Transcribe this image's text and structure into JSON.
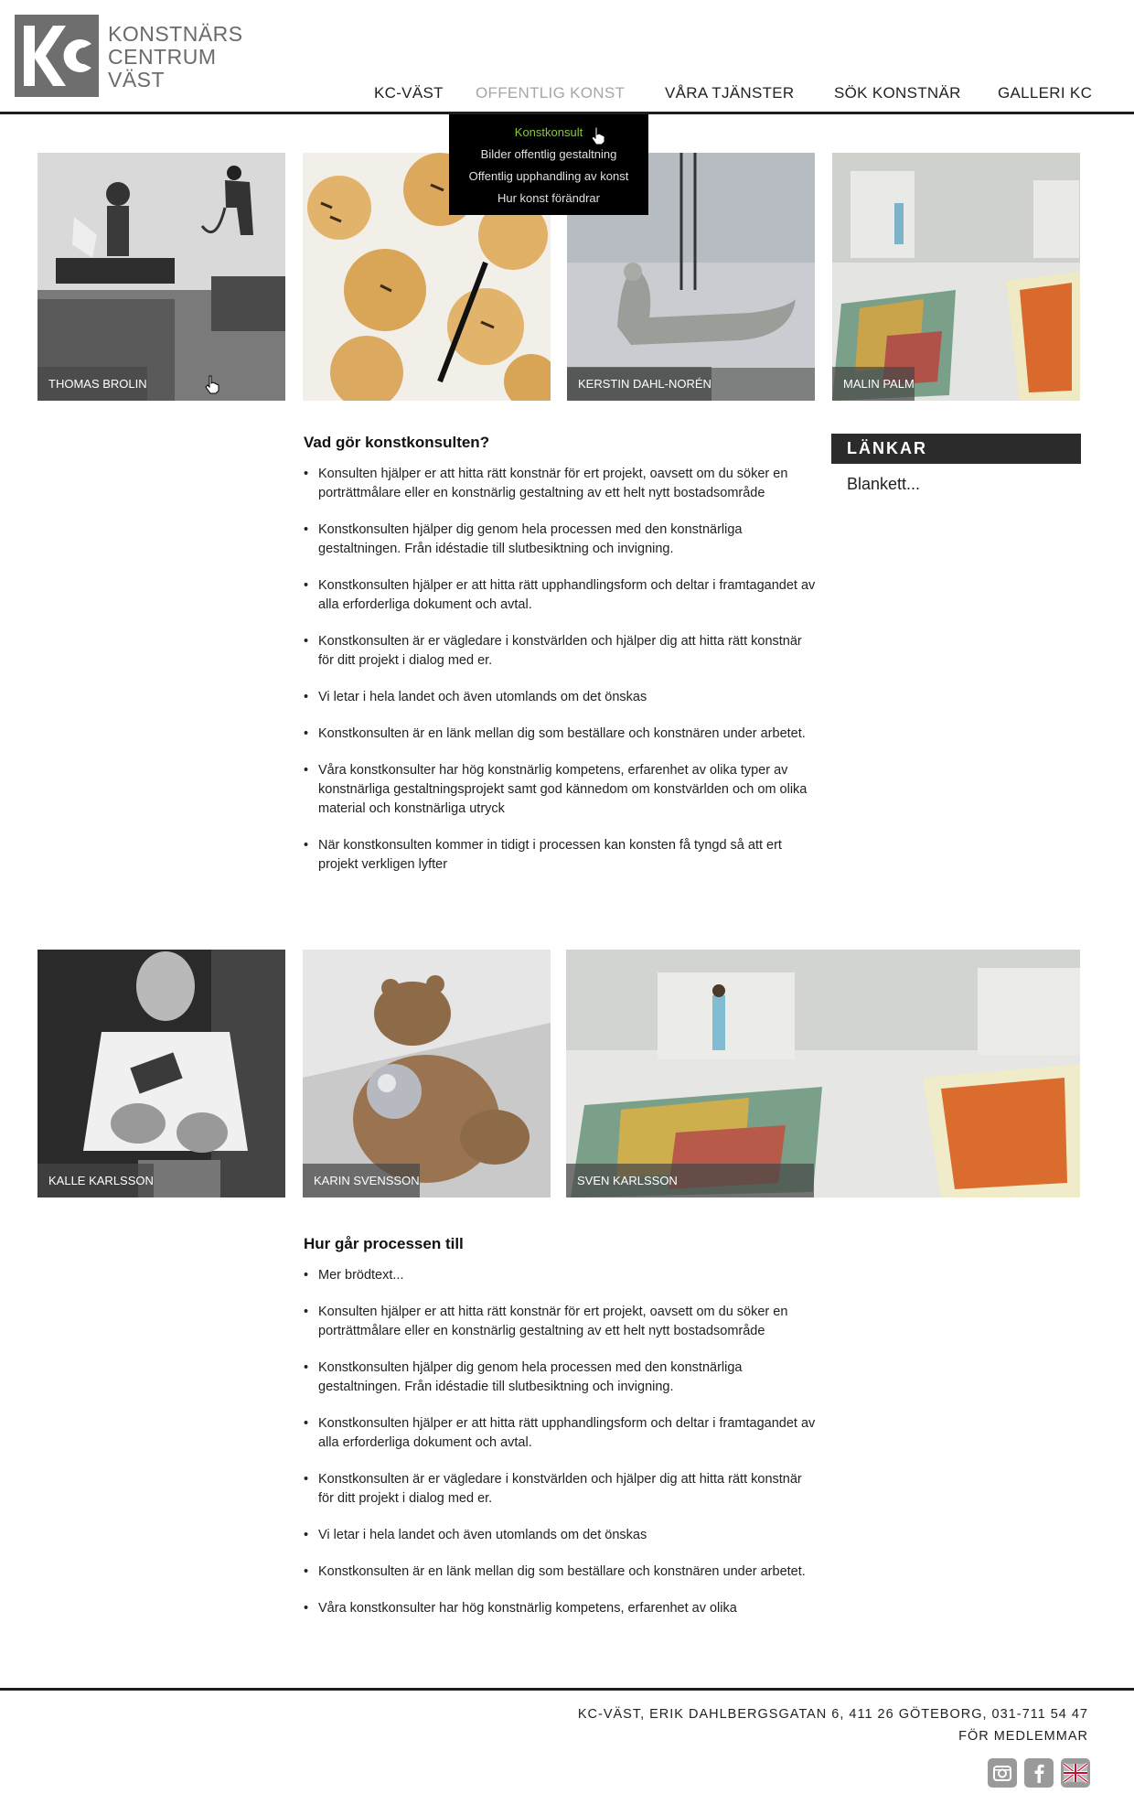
{
  "header": {
    "logo_lines": [
      "KONSTNÄRS",
      "CENTRUM",
      "VÄST"
    ],
    "nav": [
      {
        "label": "KC-VÄST"
      },
      {
        "label": "OFFENTLIG KONST"
      },
      {
        "label": "VÅRA TJÄNSTER"
      },
      {
        "label": "SÖK KONSTNÄR"
      },
      {
        "label": "GALLERI KC"
      }
    ],
    "dropdown": [
      {
        "label": "Konstkonsult"
      },
      {
        "label": "Bilder offentlig gestaltning"
      },
      {
        "label": "Offentlig upphandling av konst"
      },
      {
        "label": "Hur konst förändrar"
      }
    ]
  },
  "gallery_top": [
    {
      "caption": "THOMAS BROLIN"
    },
    {
      "caption": ""
    },
    {
      "caption": "KERSTIN DAHL-NORÉN"
    },
    {
      "caption": "MALIN PALM"
    }
  ],
  "section1": {
    "title": "Vad gör konstkonsulten?",
    "bullets": [
      "Konsulten hjälper er att hitta rätt konstnär för ert projekt, oavsett om du söker en  porträttmålare eller en konstnärlig gestaltning av ett helt nytt bostadsområde",
      "Konstkonsulten hjälper dig genom hela processen med den konstnärliga gestaltningen.  Från idéstadie till slutbesiktning och invigning.",
      "Konstkonsulten hjälper er att hitta rätt upphandlingsform och deltar i framtagandet av  alla erforderliga dokument och avtal.",
      "Konstkonsulten är er vägledare i konstvärlden och hjälper dig att hitta rätt konstnär för ditt projekt i dialog med er.",
      "Vi letar i hela landet och även utomlands om det önskas",
      "Konstkonsulten är en länk mellan dig som beställare och konstnären under arbetet.",
      "Våra konstkonsulter har hög konstnärlig kompetens, erfarenhet av olika typer av  konstnärliga gestaltningsprojekt samt god kännedom om konstvärlden och om  olika  material och konstnärliga utryck",
      "När konstkonsulten kommer in tidigt i processen kan konsten få tyngd så att ert  projekt verkligen lyfter"
    ]
  },
  "sidebar": {
    "heading": "LÄNKAR",
    "items": [
      "Blankett..."
    ]
  },
  "gallery_bottom": [
    {
      "caption": "KALLE KARLSSON"
    },
    {
      "caption": "KARIN SVENSSON"
    },
    {
      "caption": "SVEN KARLSSON"
    }
  ],
  "section2": {
    "title": "Hur går processen till",
    "bullets": [
      "Mer brödtext...",
      "Konsulten hjälper er att hitta rätt konstnär för ert projekt, oavsett om du söker en  porträttmålare eller en konstnärlig gestaltning av ett helt nytt bostadsområde",
      "Konstkonsulten hjälper dig genom hela processen med den konstnärliga gestaltningen.  Från idéstadie till slutbesiktning och invigning.",
      "Konstkonsulten hjälper er att hitta rätt upphandlingsform och deltar i framtagandet av  alla erforderliga dokument och avtal.",
      "Konstkonsulten är er vägledare i konstvärlden och hjälper dig att hitta rätt konstnär för ditt projekt i dialog med er.",
      "Vi letar i hela landet och även utomlands om det önskas",
      "Konstkonsulten är en länk mellan dig som beställare och konstnären under arbetet.",
      "Våra konstkonsulter har hög konstnärlig kompetens, erfarenhet av olika"
    ]
  },
  "footer": {
    "address": "KC-VÄST, ERIK DAHLBERGSGATAN 6, 411 26 GÖTEBORG, 031-711 54 47",
    "members": "FÖR MEDLEMMAR",
    "social_icons": [
      "instagram-icon",
      "facebook-icon",
      "uk-flag-icon"
    ]
  },
  "colors": {
    "nav_active": "#a6a6a6",
    "dropdown_current": "#8cc63f",
    "dark_bar": "#2b2b2b"
  }
}
